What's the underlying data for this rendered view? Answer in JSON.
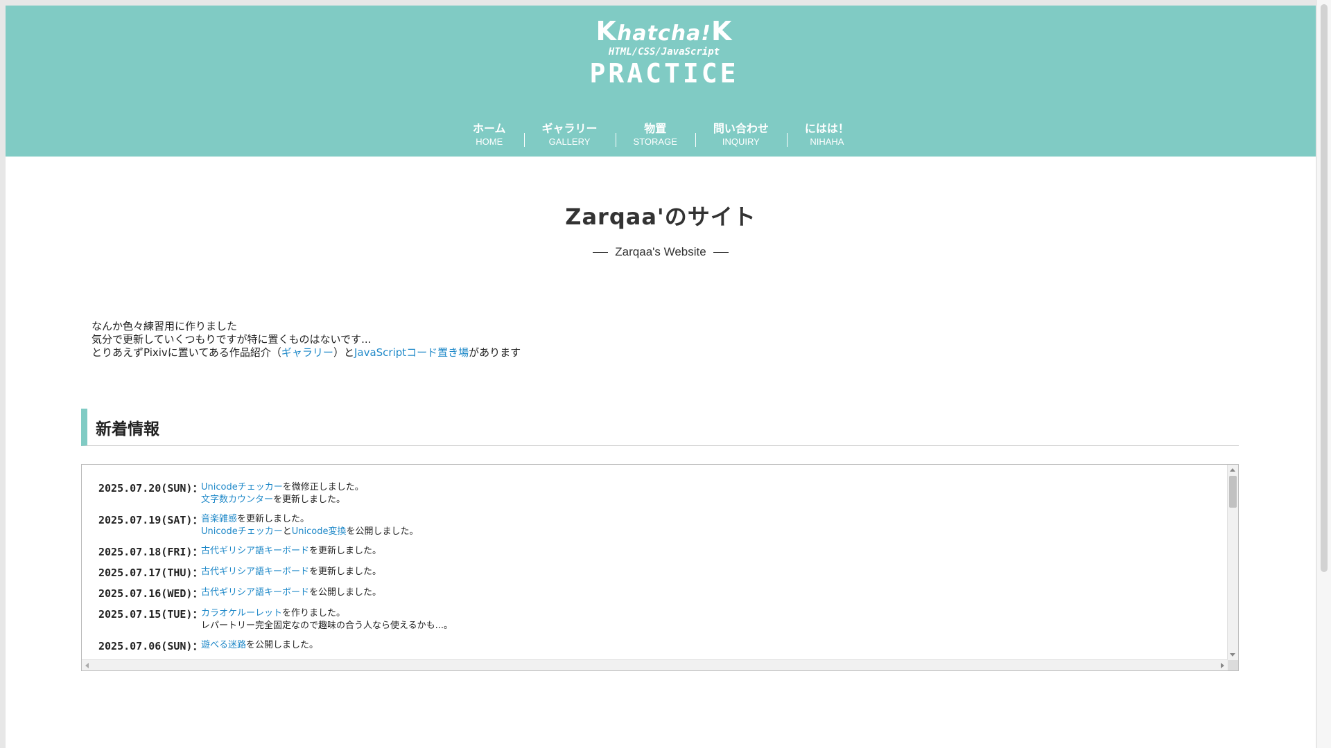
{
  "logo": {
    "brand": "Khatcha!K",
    "brand_k": "K",
    "brand_mid": "hatcha!",
    "brand_end": "K",
    "subtitle": "HTML/CSS/JavaScript",
    "practice": "PRACTICE"
  },
  "nav": {
    "items": [
      {
        "jp": "ホーム",
        "en": "HOME"
      },
      {
        "jp": "ギャラリー",
        "en": "GALLERY"
      },
      {
        "jp": "物置",
        "en": "STORAGE"
      },
      {
        "jp": "問い合わせ",
        "en": "INQUIRY"
      },
      {
        "jp": "にはは！",
        "en": "NIHAHA"
      }
    ]
  },
  "site": {
    "title": "Zarqaa'のサイト",
    "subtitle": "Zarqaa's Website"
  },
  "intro": {
    "line1": "なんか色々練習用に作りました",
    "line2": "気分で更新していくつもりですが特に置くものはないです...",
    "line3_prefix": "とりあえずPixivに置いてある作品紹介（",
    "line3_link1": "ギャラリー",
    "line3_mid": "）と",
    "line3_link2": "JavaScriptコード置き場",
    "line3_suffix": "があります"
  },
  "news": {
    "heading": "新着情報",
    "entries": [
      {
        "date": "2025.07.20(SUN)：",
        "lines": [
          {
            "link": "Unicodeチェッカー",
            "text": "を微修正しました。"
          },
          {
            "link": "文字数カウンター",
            "text": "を更新しました。"
          }
        ]
      },
      {
        "date": "2025.07.19(SAT)：",
        "lines": [
          {
            "link": "音楽雑感",
            "text": "を更新しました。"
          },
          {
            "link": "Unicodeチェッカー",
            "mid": "と",
            "link2": "Unicode変換",
            "text": "を公開しました。"
          }
        ]
      },
      {
        "date": "2025.07.18(FRI)：",
        "lines": [
          {
            "link": "古代ギリシア語キーボード",
            "text": "を更新しました。"
          }
        ]
      },
      {
        "date": "2025.07.17(THU)：",
        "lines": [
          {
            "link": "古代ギリシア語キーボード",
            "text": "を更新しました。"
          }
        ]
      },
      {
        "date": "2025.07.16(WED)：",
        "lines": [
          {
            "link": "古代ギリシア語キーボード",
            "text": "を公開しました。"
          }
        ]
      },
      {
        "date": "2025.07.15(TUE)：",
        "lines": [
          {
            "link": "カラオケルーレット",
            "text": "を作りました。"
          },
          {
            "plain": "レパートリー完全固定なので趣味の合う人なら使えるかも...。"
          }
        ]
      },
      {
        "date": "2025.07.06(SUN)：",
        "lines": [
          {
            "link": "遊べる迷路",
            "text": "を公開しました。"
          }
        ]
      }
    ]
  },
  "colors": {
    "accent": "#80cbc4",
    "link": "#1e88c8",
    "text": "#222222"
  },
  "icons": [
    "chevron-up-icon",
    "chevron-down-icon",
    "chevron-left-icon",
    "chevron-right-icon"
  ]
}
